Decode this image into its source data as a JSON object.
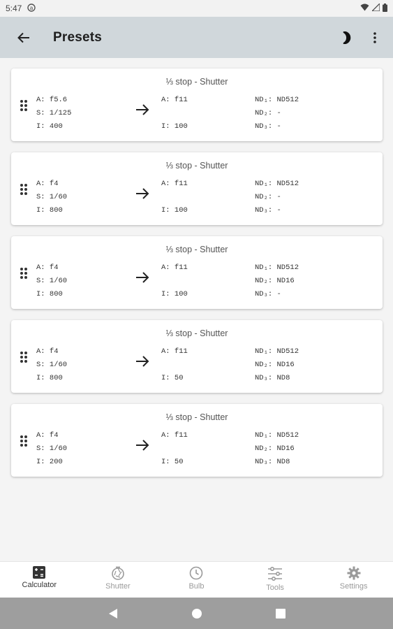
{
  "status_bar": {
    "time": "5:47"
  },
  "app_bar": {
    "title": "Presets"
  },
  "presets": [
    {
      "title": "⅓ stop - Shutter",
      "src": [
        "A: f5.6",
        "S: 1/125",
        "I: 400"
      ],
      "dst": [
        "A: f11",
        "",
        "I: 100"
      ],
      "nd": [
        "ND₁: ND512",
        "ND₂: -",
        "ND₃: -"
      ]
    },
    {
      "title": "⅓ stop - Shutter",
      "src": [
        "A: f4",
        "S: 1/60",
        "I: 800"
      ],
      "dst": [
        "A: f11",
        "",
        "I: 100"
      ],
      "nd": [
        "ND₁: ND512",
        "ND₂: -",
        "ND₃: -"
      ]
    },
    {
      "title": "⅓ stop - Shutter",
      "src": [
        "A: f4",
        "S: 1/60",
        "I: 800"
      ],
      "dst": [
        "A: f11",
        "",
        "I: 100"
      ],
      "nd": [
        "ND₁: ND512",
        "ND₂: ND16",
        "ND₃: -"
      ]
    },
    {
      "title": "⅓ stop - Shutter",
      "src": [
        "A: f4",
        "S: 1/60",
        "I: 800"
      ],
      "dst": [
        "A: f11",
        "",
        "I: 50"
      ],
      "nd": [
        "ND₁: ND512",
        "ND₂: ND16",
        "ND₃: ND8"
      ]
    },
    {
      "title": "⅓ stop - Shutter",
      "src": [
        "A: f4",
        "S: 1/60",
        "I: 200"
      ],
      "dst": [
        "A: f11",
        "",
        "I: 50"
      ],
      "nd": [
        "ND₁: ND512",
        "ND₂: ND16",
        "ND₃: ND8"
      ]
    }
  ],
  "bottom_nav": [
    {
      "label": "Calculator",
      "icon": "calculator-icon",
      "active": true
    },
    {
      "label": "Shutter",
      "icon": "shutter-icon",
      "active": false
    },
    {
      "label": "Bulb",
      "icon": "clock-icon",
      "active": false
    },
    {
      "label": "Tools",
      "icon": "sliders-icon",
      "active": false
    },
    {
      "label": "Settings",
      "icon": "gear-icon",
      "active": false
    }
  ],
  "colors": {
    "app_bar": "#d0d7db",
    "background": "#f4f4f4",
    "system_nav": "#9e9e9e"
  }
}
